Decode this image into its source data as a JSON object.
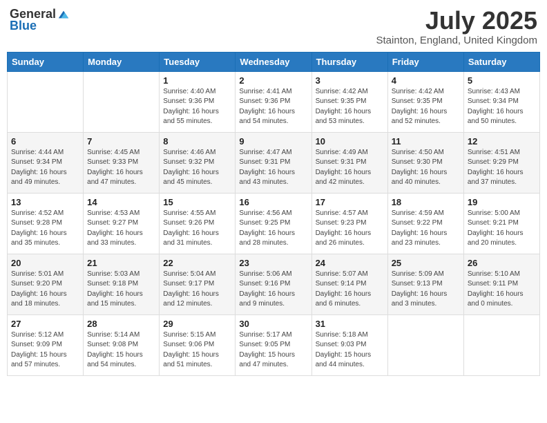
{
  "logo": {
    "general": "General",
    "blue": "Blue"
  },
  "title": "July 2025",
  "subtitle": "Stainton, England, United Kingdom",
  "days_of_week": [
    "Sunday",
    "Monday",
    "Tuesday",
    "Wednesday",
    "Thursday",
    "Friday",
    "Saturday"
  ],
  "weeks": [
    [
      {
        "day": "",
        "sunrise": "",
        "sunset": "",
        "daylight": ""
      },
      {
        "day": "",
        "sunrise": "",
        "sunset": "",
        "daylight": ""
      },
      {
        "day": "1",
        "sunrise": "Sunrise: 4:40 AM",
        "sunset": "Sunset: 9:36 PM",
        "daylight": "Daylight: 16 hours and 55 minutes."
      },
      {
        "day": "2",
        "sunrise": "Sunrise: 4:41 AM",
        "sunset": "Sunset: 9:36 PM",
        "daylight": "Daylight: 16 hours and 54 minutes."
      },
      {
        "day": "3",
        "sunrise": "Sunrise: 4:42 AM",
        "sunset": "Sunset: 9:35 PM",
        "daylight": "Daylight: 16 hours and 53 minutes."
      },
      {
        "day": "4",
        "sunrise": "Sunrise: 4:42 AM",
        "sunset": "Sunset: 9:35 PM",
        "daylight": "Daylight: 16 hours and 52 minutes."
      },
      {
        "day": "5",
        "sunrise": "Sunrise: 4:43 AM",
        "sunset": "Sunset: 9:34 PM",
        "daylight": "Daylight: 16 hours and 50 minutes."
      }
    ],
    [
      {
        "day": "6",
        "sunrise": "Sunrise: 4:44 AM",
        "sunset": "Sunset: 9:34 PM",
        "daylight": "Daylight: 16 hours and 49 minutes."
      },
      {
        "day": "7",
        "sunrise": "Sunrise: 4:45 AM",
        "sunset": "Sunset: 9:33 PM",
        "daylight": "Daylight: 16 hours and 47 minutes."
      },
      {
        "day": "8",
        "sunrise": "Sunrise: 4:46 AM",
        "sunset": "Sunset: 9:32 PM",
        "daylight": "Daylight: 16 hours and 45 minutes."
      },
      {
        "day": "9",
        "sunrise": "Sunrise: 4:47 AM",
        "sunset": "Sunset: 9:31 PM",
        "daylight": "Daylight: 16 hours and 43 minutes."
      },
      {
        "day": "10",
        "sunrise": "Sunrise: 4:49 AM",
        "sunset": "Sunset: 9:31 PM",
        "daylight": "Daylight: 16 hours and 42 minutes."
      },
      {
        "day": "11",
        "sunrise": "Sunrise: 4:50 AM",
        "sunset": "Sunset: 9:30 PM",
        "daylight": "Daylight: 16 hours and 40 minutes."
      },
      {
        "day": "12",
        "sunrise": "Sunrise: 4:51 AM",
        "sunset": "Sunset: 9:29 PM",
        "daylight": "Daylight: 16 hours and 37 minutes."
      }
    ],
    [
      {
        "day": "13",
        "sunrise": "Sunrise: 4:52 AM",
        "sunset": "Sunset: 9:28 PM",
        "daylight": "Daylight: 16 hours and 35 minutes."
      },
      {
        "day": "14",
        "sunrise": "Sunrise: 4:53 AM",
        "sunset": "Sunset: 9:27 PM",
        "daylight": "Daylight: 16 hours and 33 minutes."
      },
      {
        "day": "15",
        "sunrise": "Sunrise: 4:55 AM",
        "sunset": "Sunset: 9:26 PM",
        "daylight": "Daylight: 16 hours and 31 minutes."
      },
      {
        "day": "16",
        "sunrise": "Sunrise: 4:56 AM",
        "sunset": "Sunset: 9:25 PM",
        "daylight": "Daylight: 16 hours and 28 minutes."
      },
      {
        "day": "17",
        "sunrise": "Sunrise: 4:57 AM",
        "sunset": "Sunset: 9:23 PM",
        "daylight": "Daylight: 16 hours and 26 minutes."
      },
      {
        "day": "18",
        "sunrise": "Sunrise: 4:59 AM",
        "sunset": "Sunset: 9:22 PM",
        "daylight": "Daylight: 16 hours and 23 minutes."
      },
      {
        "day": "19",
        "sunrise": "Sunrise: 5:00 AM",
        "sunset": "Sunset: 9:21 PM",
        "daylight": "Daylight: 16 hours and 20 minutes."
      }
    ],
    [
      {
        "day": "20",
        "sunrise": "Sunrise: 5:01 AM",
        "sunset": "Sunset: 9:20 PM",
        "daylight": "Daylight: 16 hours and 18 minutes."
      },
      {
        "day": "21",
        "sunrise": "Sunrise: 5:03 AM",
        "sunset": "Sunset: 9:18 PM",
        "daylight": "Daylight: 16 hours and 15 minutes."
      },
      {
        "day": "22",
        "sunrise": "Sunrise: 5:04 AM",
        "sunset": "Sunset: 9:17 PM",
        "daylight": "Daylight: 16 hours and 12 minutes."
      },
      {
        "day": "23",
        "sunrise": "Sunrise: 5:06 AM",
        "sunset": "Sunset: 9:16 PM",
        "daylight": "Daylight: 16 hours and 9 minutes."
      },
      {
        "day": "24",
        "sunrise": "Sunrise: 5:07 AM",
        "sunset": "Sunset: 9:14 PM",
        "daylight": "Daylight: 16 hours and 6 minutes."
      },
      {
        "day": "25",
        "sunrise": "Sunrise: 5:09 AM",
        "sunset": "Sunset: 9:13 PM",
        "daylight": "Daylight: 16 hours and 3 minutes."
      },
      {
        "day": "26",
        "sunrise": "Sunrise: 5:10 AM",
        "sunset": "Sunset: 9:11 PM",
        "daylight": "Daylight: 16 hours and 0 minutes."
      }
    ],
    [
      {
        "day": "27",
        "sunrise": "Sunrise: 5:12 AM",
        "sunset": "Sunset: 9:09 PM",
        "daylight": "Daylight: 15 hours and 57 minutes."
      },
      {
        "day": "28",
        "sunrise": "Sunrise: 5:14 AM",
        "sunset": "Sunset: 9:08 PM",
        "daylight": "Daylight: 15 hours and 54 minutes."
      },
      {
        "day": "29",
        "sunrise": "Sunrise: 5:15 AM",
        "sunset": "Sunset: 9:06 PM",
        "daylight": "Daylight: 15 hours and 51 minutes."
      },
      {
        "day": "30",
        "sunrise": "Sunrise: 5:17 AM",
        "sunset": "Sunset: 9:05 PM",
        "daylight": "Daylight: 15 hours and 47 minutes."
      },
      {
        "day": "31",
        "sunrise": "Sunrise: 5:18 AM",
        "sunset": "Sunset: 9:03 PM",
        "daylight": "Daylight: 15 hours and 44 minutes."
      },
      {
        "day": "",
        "sunrise": "",
        "sunset": "",
        "daylight": ""
      },
      {
        "day": "",
        "sunrise": "",
        "sunset": "",
        "daylight": ""
      }
    ]
  ]
}
